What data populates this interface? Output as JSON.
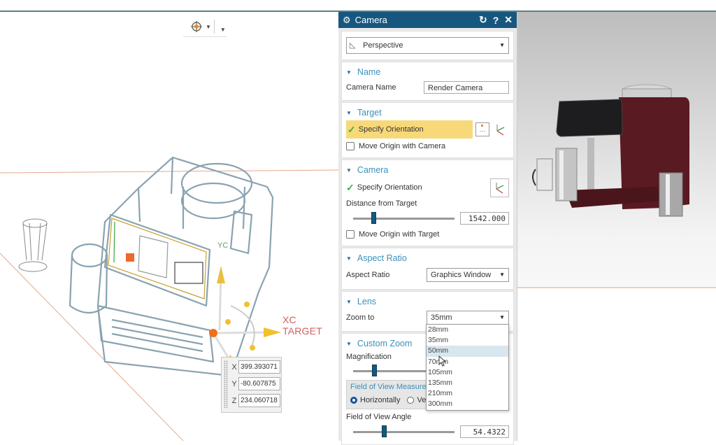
{
  "viewport": {
    "toolbar": {
      "snap_icon": "target-crosshair-icon"
    },
    "labels": {
      "xc": "XC TARGET",
      "yc": "YC"
    },
    "coords": [
      {
        "axis": "X",
        "value": "399.393071"
      },
      {
        "axis": "Y",
        "value": "-80.607875"
      },
      {
        "axis": "Z",
        "value": "234.060718"
      }
    ]
  },
  "dialog": {
    "title": "Camera",
    "title_icons": [
      "gear-icon",
      "reset-icon",
      "help-icon",
      "close-icon"
    ],
    "type_select": {
      "value": "Perspective",
      "icon": "camera-perspective-icon"
    },
    "name_section": {
      "title": "Name",
      "camera_name_label": "Camera Name",
      "camera_name_value": "Render Camera"
    },
    "target_section": {
      "title": "Target",
      "specify_orientation": "Specify Orientation",
      "move_origin_label": "Move Origin with Camera",
      "move_origin_checked": false
    },
    "camera_section": {
      "title": "Camera",
      "specify_orientation": "Specify Orientation",
      "distance_label": "Distance from Target",
      "distance_value": "1542.000",
      "distance_slider_fraction": 0.2,
      "move_origin_label": "Move Origin with Target",
      "move_origin_checked": false
    },
    "aspect_section": {
      "title": "Aspect Ratio",
      "label": "Aspect Ratio",
      "value": "Graphics Window"
    },
    "lens_section": {
      "title": "Lens",
      "zoom_label": "Zoom to",
      "zoom_value": "35mm",
      "zoom_options": [
        "28mm",
        "35mm",
        "50mm",
        "70mm",
        "105mm",
        "135mm",
        "210mm",
        "300mm"
      ],
      "highlighted_option": "50mm"
    },
    "custom_zoom_section": {
      "title": "Custom Zoom",
      "magnification_label": "Magnification",
      "magnification_slider_fraction": 0.15,
      "fov_group_title": "Field of View Measured",
      "fov_horizontal": "Horizontally",
      "fov_vertical": "Vertically",
      "fov_selected": "Horizontally",
      "fov_angle_label": "Field of View Angle",
      "fov_angle_value": "54.4322",
      "fov_angle_slider_fraction": 0.3
    }
  },
  "colors": {
    "title_bar": "#16577f",
    "section_header": "#3b90bb",
    "highlight": "#f8d97a",
    "check": "#3fae3f",
    "xc_label": "#d0605e",
    "machine_body": "#5a1a22"
  }
}
